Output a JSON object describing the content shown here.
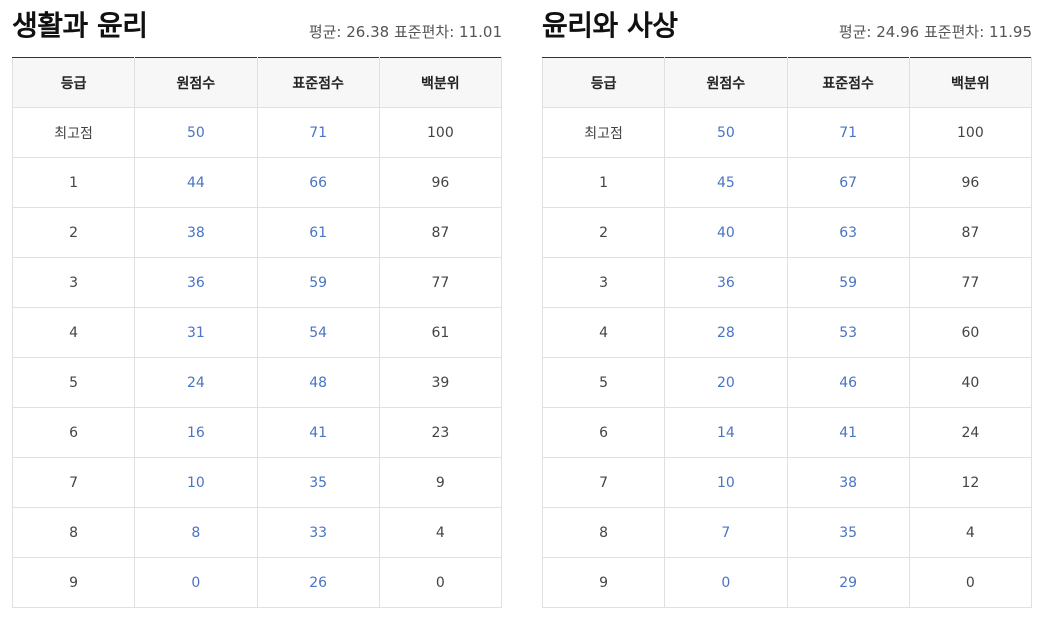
{
  "panels": [
    {
      "title": "생활과 윤리",
      "mean_label": "평균:",
      "mean_value": "26.38",
      "sd_label": "표준편차:",
      "sd_value": "11.01",
      "headers": [
        "등급",
        "원점수",
        "표준점수",
        "백분위"
      ],
      "rows": [
        [
          "최고점",
          "50",
          "71",
          "100"
        ],
        [
          "1",
          "44",
          "66",
          "96"
        ],
        [
          "2",
          "38",
          "61",
          "87"
        ],
        [
          "3",
          "36",
          "59",
          "77"
        ],
        [
          "4",
          "31",
          "54",
          "61"
        ],
        [
          "5",
          "24",
          "48",
          "39"
        ],
        [
          "6",
          "16",
          "41",
          "23"
        ],
        [
          "7",
          "10",
          "35",
          "9"
        ],
        [
          "8",
          "8",
          "33",
          "4"
        ],
        [
          "9",
          "0",
          "26",
          "0"
        ]
      ]
    },
    {
      "title": "윤리와 사상",
      "mean_label": "평균:",
      "mean_value": "24.96",
      "sd_label": "표준편차:",
      "sd_value": "11.95",
      "headers": [
        "등급",
        "원점수",
        "표준점수",
        "백분위"
      ],
      "rows": [
        [
          "최고점",
          "50",
          "71",
          "100"
        ],
        [
          "1",
          "45",
          "67",
          "96"
        ],
        [
          "2",
          "40",
          "63",
          "87"
        ],
        [
          "3",
          "36",
          "59",
          "77"
        ],
        [
          "4",
          "28",
          "53",
          "60"
        ],
        [
          "5",
          "20",
          "46",
          "40"
        ],
        [
          "6",
          "14",
          "41",
          "24"
        ],
        [
          "7",
          "10",
          "38",
          "12"
        ],
        [
          "8",
          "7",
          "35",
          "4"
        ],
        [
          "9",
          "0",
          "29",
          "0"
        ]
      ]
    }
  ],
  "colors": {
    "link_number": "#4a74c4",
    "plain_text": "#444444",
    "header_bg": "#f7f7f7",
    "top_rule": "#333333",
    "grid": "#e0e0e0"
  }
}
